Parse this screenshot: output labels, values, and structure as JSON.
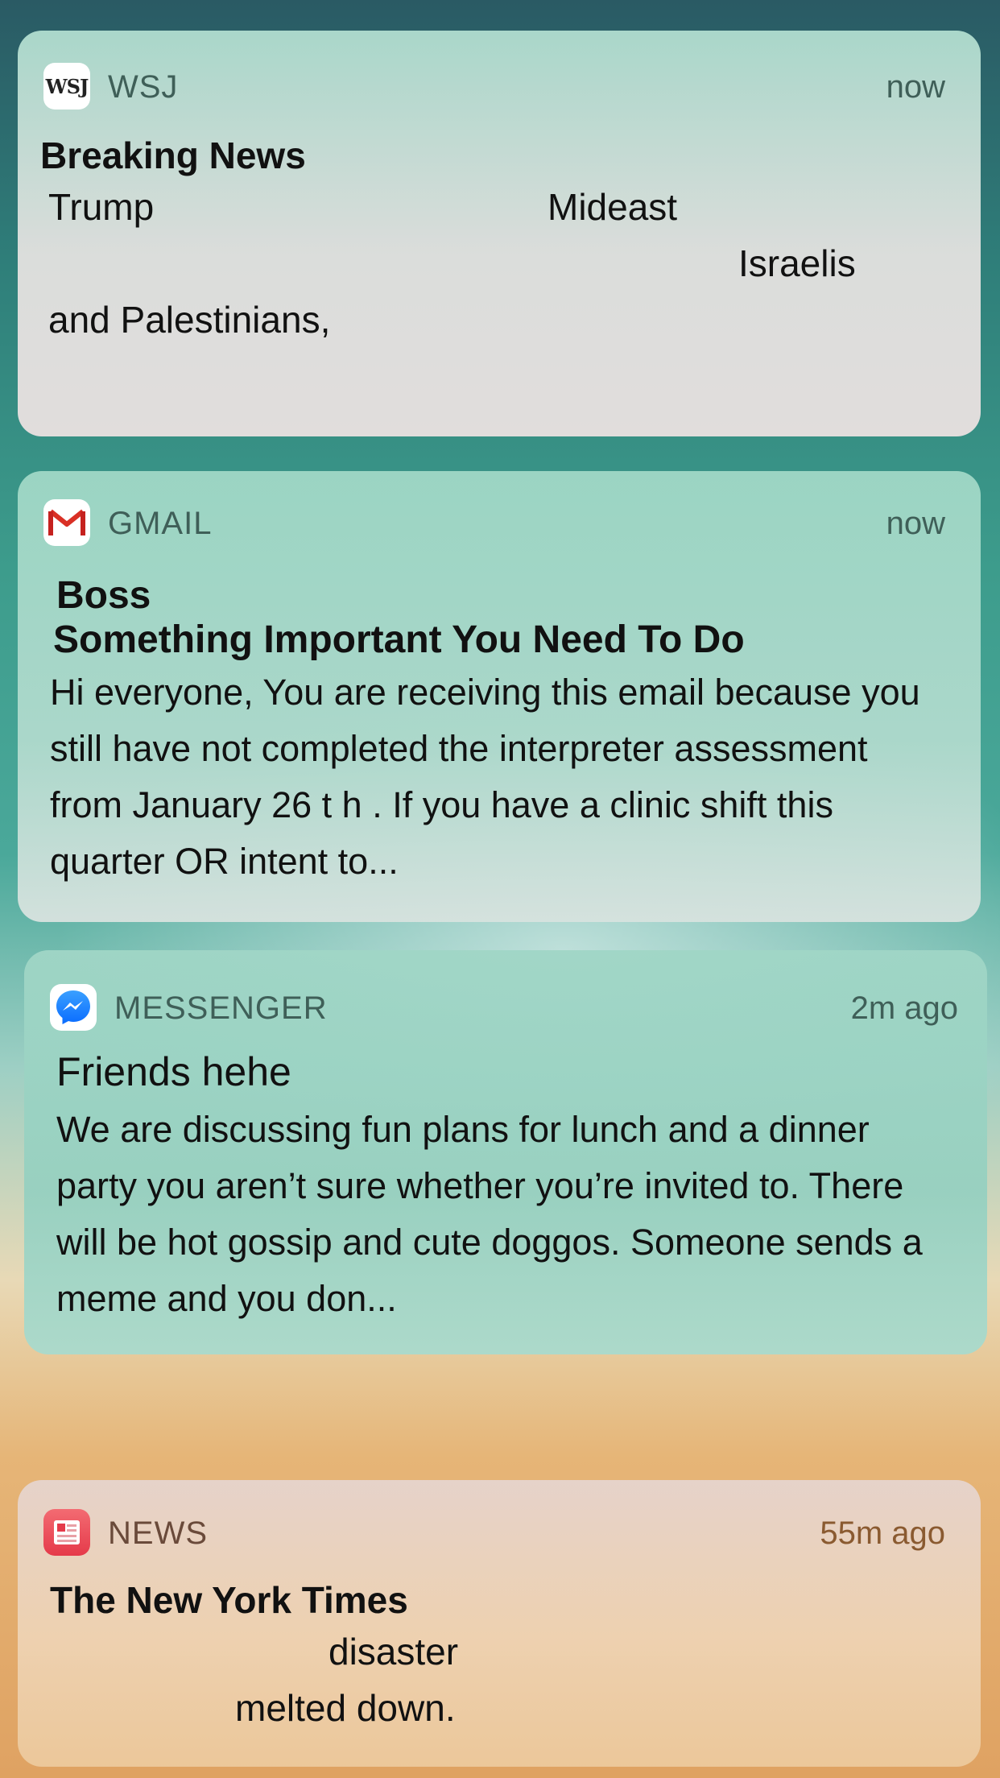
{
  "notifications": {
    "wsj": {
      "app_name": "WSJ",
      "icon_text": "WSJ",
      "time": "now",
      "title": "Breaking News",
      "lines": [
        "Trump",
        "Mideast",
        "Israelis",
        "and Palestinians,"
      ]
    },
    "gmail": {
      "app_name": "GMAIL",
      "time": "now",
      "sender": "Boss",
      "subject": "Something Important You Need To Do",
      "body": "Hi everyone, You are receiving this email because you still have not completed the interpreter assessment from January 26 t h . If you have a clinic shift this quarter OR intent to..."
    },
    "messenger": {
      "app_name": "MESSENGER",
      "time": "2m ago",
      "title": "Friends hehe",
      "body": "We are discussing fun plans for lunch and a dinner party you aren’t sure whether you’re invited to. There will be hot gossip and cute doggos. Someone sends a meme and you don..."
    },
    "news": {
      "app_name": "NEWS",
      "time": "55m ago",
      "title": "The New York Times",
      "lines": [
        "disaster",
        "melted down."
      ]
    }
  }
}
